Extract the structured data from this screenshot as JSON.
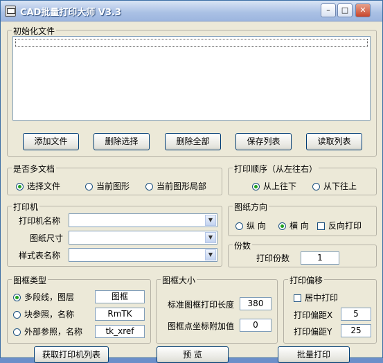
{
  "window": {
    "title": "CAD批量打印大师 V3.3",
    "min": "–",
    "max": "□",
    "close": "✕"
  },
  "init_files": {
    "legend": "初始化文件",
    "buttons": {
      "add": "添加文件",
      "remove_sel": "删除选择",
      "remove_all": "删除全部",
      "save_list": "保存列表",
      "read_list": "读取列表"
    }
  },
  "multi_doc": {
    "legend": "是否多文档",
    "options": [
      "选择文件",
      "当前图形",
      "当前图形局部"
    ],
    "selected": "选择文件"
  },
  "print_order": {
    "legend": "打印顺序（从左往右）",
    "options": [
      "从上往下",
      "从下往上"
    ],
    "selected": "从上往下"
  },
  "printer": {
    "legend": "打印机",
    "name_label": "打印机名称",
    "name_value": "",
    "paper_label": "图纸尺寸",
    "paper_value": "",
    "style_label": "样式表名称",
    "style_value": ""
  },
  "orientation": {
    "legend": "图纸方向",
    "options": [
      "纵 向",
      "横 向"
    ],
    "selected": "横 向",
    "reverse_label": "反向打印",
    "reverse_checked": false
  },
  "copies": {
    "legend": "份数",
    "label": "打印份数",
    "value": "1"
  },
  "frame_type": {
    "legend": "图框类型",
    "options": [
      {
        "label": "多段线，图层",
        "value": "图框"
      },
      {
        "label": "块参照，名称",
        "value": "RmTK"
      },
      {
        "label": "外部参照，名称",
        "value": "tk_xref"
      }
    ],
    "selected": "多段线，图层"
  },
  "frame_size": {
    "legend": "图框大小",
    "std_len_label": "标准图框打印长度",
    "std_len_value": "380",
    "coord_add_label": "图框点坐标附加值",
    "coord_add_value": "0"
  },
  "offset": {
    "legend": "打印偏移",
    "center_label": "居中打印",
    "center_checked": false,
    "x_label": "打印偏距X",
    "x_value": "5",
    "y_label": "打印偏距Y",
    "y_value": "25"
  },
  "bottom_buttons": {
    "get_printers": "获取打印机列表",
    "preview": "预 览",
    "batch_print": "批量打印"
  }
}
